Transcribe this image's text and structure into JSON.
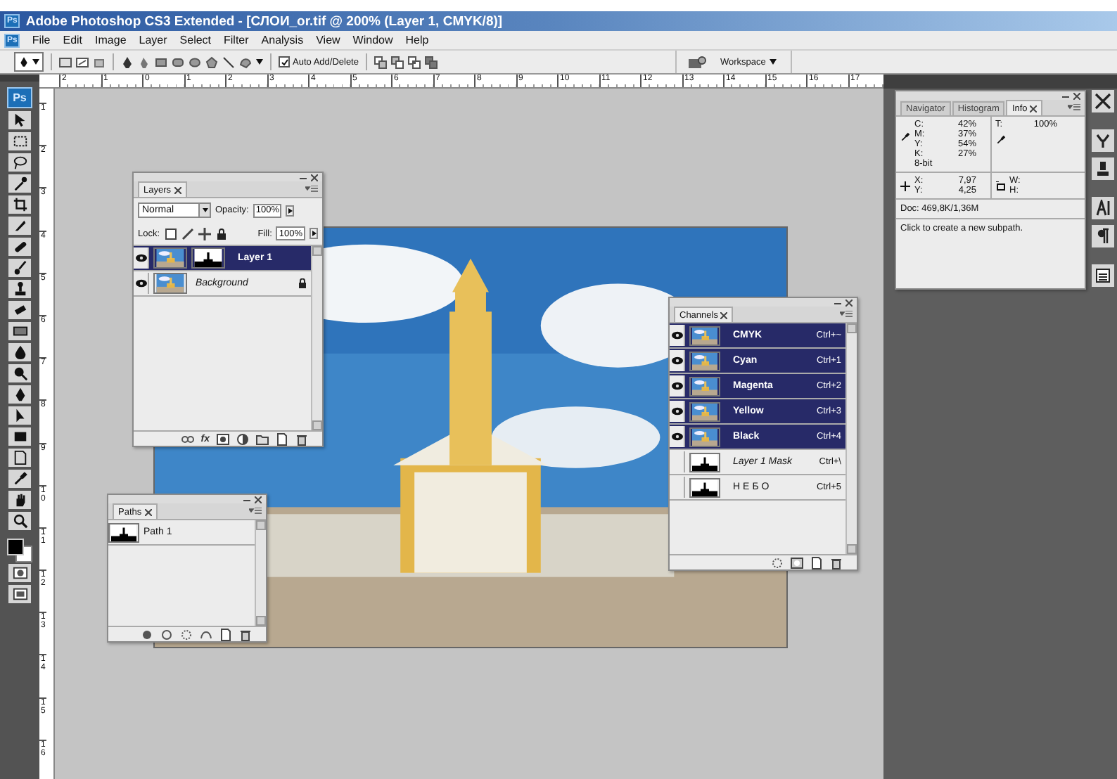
{
  "window": {
    "title": "Adobe Photoshop CS3 Extended - [СЛОИ_or.tif @ 200% (Layer 1, CMYK/8)]",
    "app_icon": "Ps"
  },
  "menu": {
    "app_icon": "Ps",
    "items": [
      "File",
      "Edit",
      "Image",
      "Layer",
      "Select",
      "Filter",
      "Analysis",
      "View",
      "Window",
      "Help"
    ]
  },
  "options_bar": {
    "auto_add_delete": {
      "label": "Auto Add/Delete",
      "checked": true
    },
    "workspace": "Workspace"
  },
  "rulers": {
    "horizontal": [
      "2",
      "1",
      "0",
      "1",
      "2",
      "3",
      "4",
      "5",
      "6",
      "7",
      "8",
      "9",
      "10",
      "11",
      "12",
      "13",
      "14",
      "15",
      "16",
      "17"
    ],
    "vertical": [
      "1",
      "2",
      "3",
      "4",
      "5",
      "6",
      "7",
      "8",
      "9",
      "10",
      "11",
      "12",
      "13",
      "14",
      "15",
      "16"
    ]
  },
  "toolbox": {
    "logo": "Ps"
  },
  "layers_panel": {
    "tab": "Layers",
    "blend_mode": "Normal",
    "opacity_label": "Opacity:",
    "opacity": "100%",
    "lock_label": "Lock:",
    "fill_label": "Fill:",
    "fill": "100%",
    "fx": "fx",
    "layers": [
      {
        "name": "Layer 1",
        "visible": true,
        "selected": true,
        "locked": false,
        "has_mask": true
      },
      {
        "name": "Background",
        "visible": true,
        "selected": false,
        "locked": true,
        "has_mask": false
      }
    ]
  },
  "channels_panel": {
    "tab": "Channels",
    "channels": [
      {
        "name": "CMYK",
        "shortcut": "Ctrl+~",
        "kind": "color",
        "visible": true,
        "selected": true
      },
      {
        "name": "Cyan",
        "shortcut": "Ctrl+1",
        "kind": "color",
        "visible": true,
        "selected": true
      },
      {
        "name": "Magenta",
        "shortcut": "Ctrl+2",
        "kind": "color",
        "visible": true,
        "selected": true
      },
      {
        "name": "Yellow",
        "shortcut": "Ctrl+3",
        "kind": "color",
        "visible": true,
        "selected": true
      },
      {
        "name": "Black",
        "shortcut": "Ctrl+4",
        "kind": "color",
        "visible": true,
        "selected": true
      },
      {
        "name": "Layer 1 Mask",
        "shortcut": "Ctrl+\\",
        "kind": "mask",
        "visible": false,
        "selected": false
      },
      {
        "name": "НЕБО",
        "shortcut": "Ctrl+5",
        "kind": "alpha",
        "visible": false,
        "selected": false
      }
    ]
  },
  "paths_panel": {
    "tab": "Paths",
    "paths": [
      "Path 1"
    ]
  },
  "info_panel": {
    "tabs": [
      {
        "label": "Navigator",
        "selected": false
      },
      {
        "label": "Histogram",
        "selected": false
      },
      {
        "label": "Info",
        "selected": true
      }
    ],
    "cmyk": [
      {
        "label": "C:",
        "value": "42%"
      },
      {
        "label": "M:",
        "value": "37%"
      },
      {
        "label": "Y:",
        "value": "54%"
      },
      {
        "label": "K:",
        "value": "27%"
      }
    ],
    "bit_depth": "8-bit",
    "opacity": {
      "label": "T:",
      "value": "100%"
    },
    "position": [
      {
        "label": "X:",
        "value": "7,97"
      },
      {
        "label": "Y:",
        "value": "4,25"
      }
    ],
    "size": [
      "W:",
      "H:"
    ],
    "doc": "Doc: 469,8K/1,36M",
    "hint": "Click to create a new subpath."
  }
}
